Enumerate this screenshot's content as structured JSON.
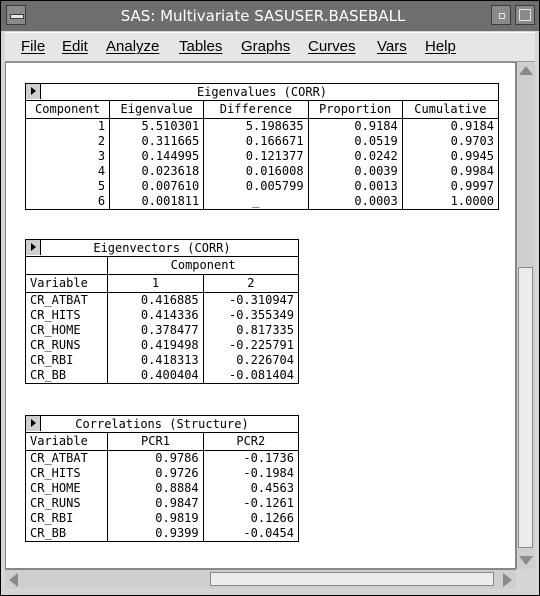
{
  "window": {
    "title": "SAS: Multivariate SASUSER.BASEBALL"
  },
  "menubar": {
    "items": [
      "File",
      "Edit",
      "Analyze",
      "Tables",
      "Graphs",
      "Curves",
      "Vars",
      "Help"
    ]
  },
  "eigenvalues": {
    "title": "Eigenvalues (CORR)",
    "columns": [
      "Component",
      "Eigenvalue",
      "Difference",
      "Proportion",
      "Cumulative"
    ],
    "rows": [
      [
        "1",
        "5.510301",
        "5.198635",
        "0.9184",
        "0.9184"
      ],
      [
        "2",
        "0.311665",
        "0.166671",
        "0.0519",
        "0.9703"
      ],
      [
        "3",
        "0.144995",
        "0.121377",
        "0.0242",
        "0.9945"
      ],
      [
        "4",
        "0.023618",
        "0.016008",
        "0.0039",
        "0.9984"
      ],
      [
        "5",
        "0.007610",
        "0.005799",
        "0.0013",
        "0.9997"
      ],
      [
        "6",
        "0.001811",
        "_",
        "0.0003",
        "1.0000"
      ]
    ]
  },
  "eigenvectors": {
    "title": "Eigenvectors (CORR)",
    "group_header": "Component",
    "columns": [
      "Variable",
      "1",
      "2"
    ],
    "rows": [
      [
        "CR_ATBAT",
        "0.416885",
        "-0.310947"
      ],
      [
        "CR_HITS",
        "0.414336",
        "-0.355349"
      ],
      [
        "CR_HOME",
        "0.378477",
        "0.817335"
      ],
      [
        "CR_RUNS",
        "0.419498",
        "-0.225791"
      ],
      [
        "CR_RBI",
        "0.418313",
        "0.226704"
      ],
      [
        "CR_BB",
        "0.400404",
        "-0.081404"
      ]
    ]
  },
  "correlations": {
    "title": "Correlations (Structure)",
    "columns": [
      "Variable",
      "PCR1",
      "PCR2"
    ],
    "rows": [
      [
        "CR_ATBAT",
        "0.9786",
        "-0.1736"
      ],
      [
        "CR_HITS",
        "0.9726",
        "-0.1984"
      ],
      [
        "CR_HOME",
        "0.8884",
        "0.4563"
      ],
      [
        "CR_RUNS",
        "0.9847",
        "-0.1261"
      ],
      [
        "CR_RBI",
        "0.9819",
        "0.1266"
      ],
      [
        "CR_BB",
        "0.9399",
        "-0.0454"
      ]
    ]
  }
}
